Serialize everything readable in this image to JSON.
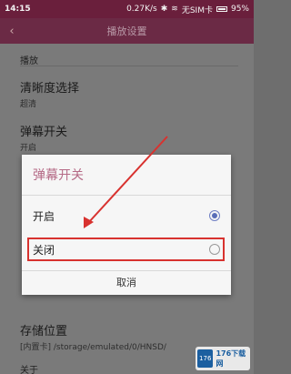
{
  "status_bar": {
    "time": "14:15",
    "speed": "0.27K/s",
    "sim": "无SIM卡",
    "battery": "95%"
  },
  "toolbar": {
    "title": "播放设置"
  },
  "settings": {
    "section_playback": "播放",
    "quality_title": "清晰度选择",
    "quality_value": "超清",
    "danmaku_title": "弹幕开关",
    "danmaku_value": "开启",
    "storage_title": "存储位置",
    "storage_value": "[内置卡] /storage/emulated/0/HNSD/",
    "about_title": "关于"
  },
  "dialog": {
    "title": "弹幕开关",
    "options": [
      {
        "label": "开启",
        "selected": true
      },
      {
        "label": "关闭",
        "selected": false
      }
    ],
    "cancel_label": "取消"
  },
  "watermark": {
    "badge": "176",
    "text": "176下载网"
  },
  "colors": {
    "accent": "#6b2a45",
    "dialog_title": "#b56a86",
    "radio": "#5a6eb8",
    "highlight": "#d8322f"
  }
}
